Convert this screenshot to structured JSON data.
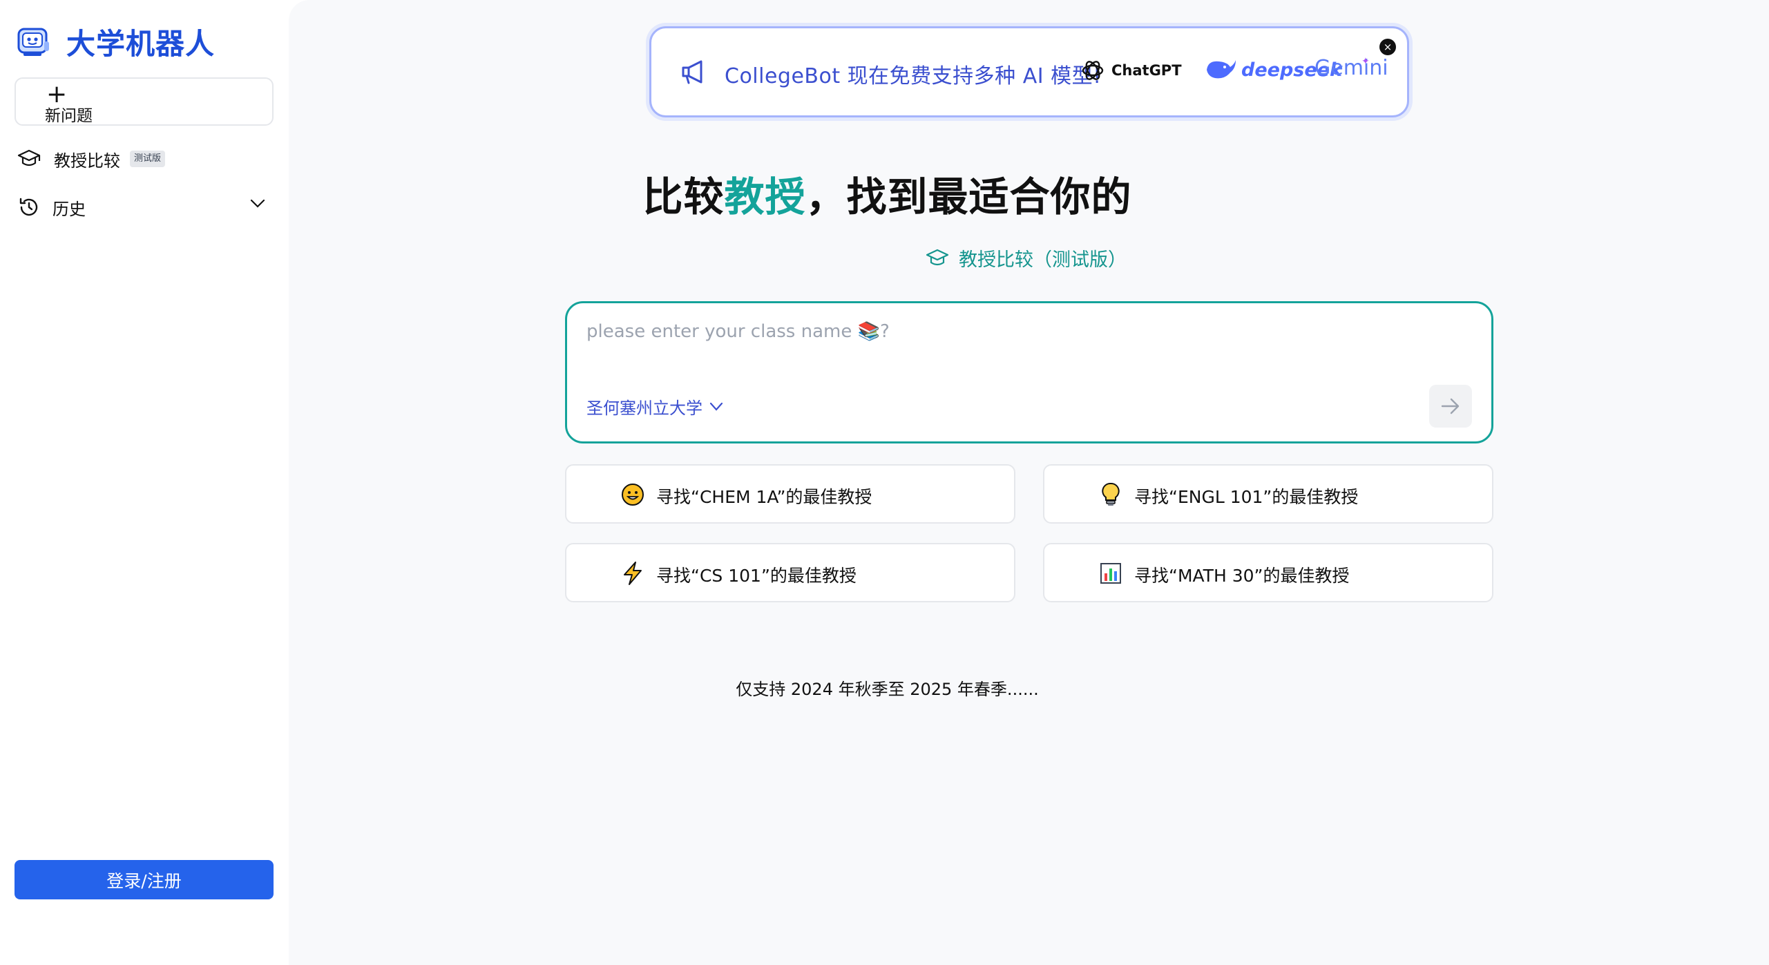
{
  "sidebar": {
    "brand_name": "大学机器人",
    "new_question_label": "新问题",
    "items": [
      {
        "label": "教授比较",
        "badge": "测试版",
        "icon": "graduation-cap-icon"
      },
      {
        "label": "历史",
        "icon": "clock-icon"
      }
    ],
    "login_label": "登录/注册"
  },
  "banner": {
    "text": "CollegeBot 现在免费支持多种 AI 模型!",
    "models": [
      "ChatGPT",
      "deepseek",
      "Gemini"
    ],
    "close_label": "×"
  },
  "hero": {
    "title_prefix": "比较",
    "title_accent": "教授",
    "title_suffix": "，找到最适合你的"
  },
  "subtitle": "教授比较（测试版）",
  "query": {
    "placeholder": "please enter your class name 📚?",
    "value": "",
    "school": "圣何塞州立大学"
  },
  "suggestions": [
    {
      "text": "寻找“CHEM 1A”的最佳教授",
      "icon": "smiley-icon"
    },
    {
      "text": "寻找“ENGL 101”的最佳教授",
      "icon": "lightbulb-icon"
    },
    {
      "text": "寻找“CS 101”的最佳教授",
      "icon": "lightning-icon"
    },
    {
      "text": "寻找“MATH 30”的最佳教授",
      "icon": "bar-chart-icon"
    }
  ],
  "note": "仅支持 2024 年秋季至 2025 年春季......",
  "colors": {
    "brand": "#1d4ed8",
    "accent": "#14a39a",
    "primary_button": "#2563eb",
    "banner_text": "#3b4fcf"
  }
}
